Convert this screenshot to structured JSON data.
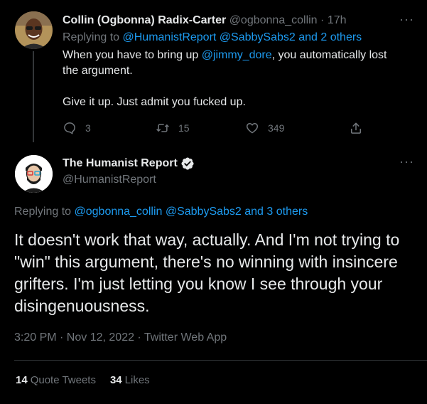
{
  "colors": {
    "background": "#000000",
    "text": "#e7e9ea",
    "muted": "#71767b",
    "link": "#1d9bf0",
    "divider": "#2f3336",
    "verified": "#e7e9ea"
  },
  "reply_tweet": {
    "author_name": "Collin (Ogbonna) Radix-Carter",
    "handle": "@ogbonna_collin",
    "separator": "·",
    "time": "17h",
    "replying_prefix": "Replying to",
    "replying_targets": "@HumanistReport @SabbySabs2 and 2 others",
    "text_part1": "When you have to bring up ",
    "text_mention": "@jimmy_dore",
    "text_part2": ", you automatically lost the argument.",
    "text_para2": "Give it up.  Just admit you fucked up.",
    "reply_count": "3",
    "retweet_count": "15",
    "like_count": "349",
    "icons": [
      "comment-icon",
      "retweet-icon",
      "like-icon",
      "share-icon",
      "more-icon"
    ]
  },
  "main_tweet": {
    "author_name": "The Humanist Report",
    "handle": "@HumanistReport",
    "verified_icon": "verified-badge-icon",
    "replying_prefix": "Replying to",
    "replying_targets": "@ogbonna_collin @SabbySabs2 and 3 others",
    "text": "It doesn't work that way, actually. And I'm not trying to \"win\" this argument, there's no winning with insincere grifters. I'm just letting you know I see through your disingenuousness.",
    "timestamp": "3:20 PM · Nov 12, 2022 · Twitter Web App",
    "quote_tweets_count": "14",
    "quote_tweets_label": "Quote Tweets",
    "likes_count": "34",
    "likes_label": "Likes"
  }
}
